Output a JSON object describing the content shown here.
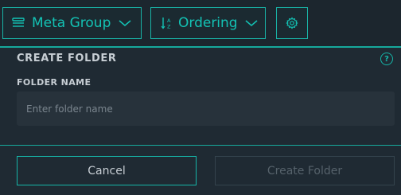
{
  "toolbar": {
    "meta_group_label": "Meta Group",
    "meta_group_icon": "list-icon",
    "ordering_label": "Ordering",
    "ordering_icon": "sort-icon",
    "settings_icon": "gear-icon",
    "accent_color": "#13c2b4"
  },
  "dialog": {
    "title": "CREATE FOLDER",
    "help_icon_text": "?",
    "field_label": "FOLDER NAME",
    "field_placeholder": "Enter folder name",
    "field_value": "",
    "cancel_label": "Cancel",
    "create_label": "Create Folder",
    "create_enabled": false
  }
}
